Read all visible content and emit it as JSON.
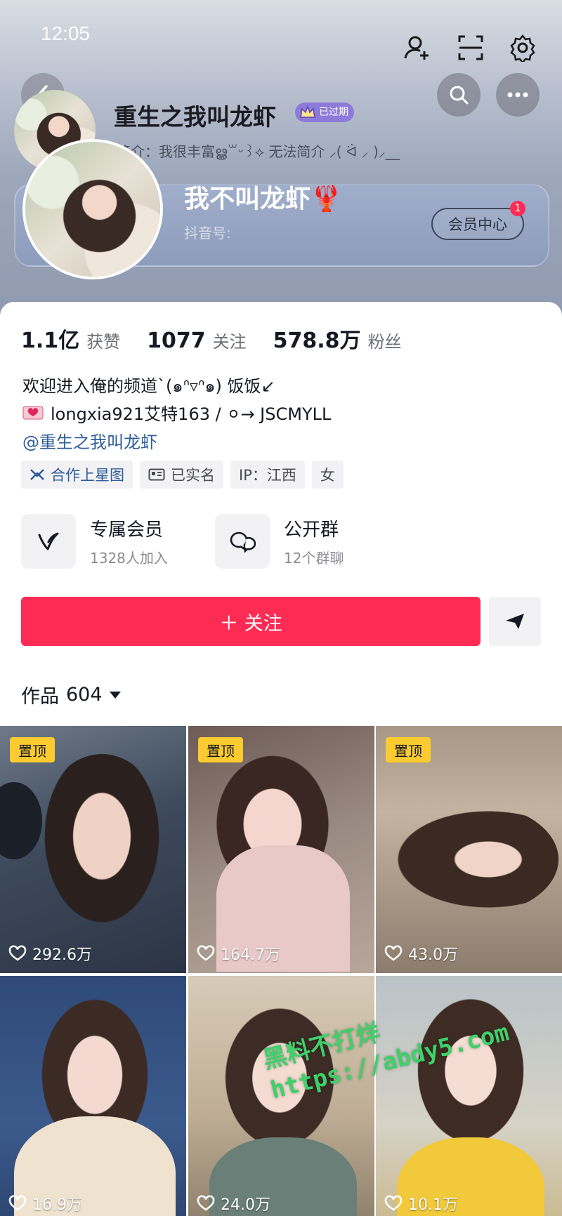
{
  "status_bar": {
    "time": "12:05"
  },
  "header": {
    "mini_name": "重生之我叫龙虾",
    "expired_badge": "已过期",
    "mini_intro": "简介：我很丰富ൠ꒳ᵕ꒱⟡ 无法简介 ⸝( ᐛ ⸝ )⸝__",
    "big_name": "我不叫龙虾🦞",
    "douyin_id_label": "抖音号:",
    "member_center_label": "会员中心",
    "member_center_badge": "1"
  },
  "stats": [
    {
      "value": "1.1亿",
      "label": "获赞"
    },
    {
      "value": "1077",
      "label": "关注"
    },
    {
      "value": "578.8万",
      "label": "粉丝"
    }
  ],
  "bio": {
    "line1": "欢迎进入俺的频道`(๑ᐢ▿ᐢ๑) 饭饭↙",
    "line2": "longxia921艾特163  /  ⚪→  JSCMYLL",
    "mention": "@重生之我叫龙虾"
  },
  "tags": [
    {
      "label": "合作上星图",
      "icon": "star-map-icon"
    },
    {
      "label": "已实名",
      "icon": "id-card-icon"
    },
    {
      "label": "IP：江西",
      "icon": ""
    },
    {
      "label": "女",
      "icon": ""
    }
  ],
  "entries": [
    {
      "title": "专属会员",
      "sub": "1328人加入",
      "icon": "vip-v-icon"
    },
    {
      "title": "公开群",
      "sub": "12个群聊",
      "icon": "group-chat-icon"
    }
  ],
  "follow_button": "＋ 关注",
  "works": {
    "label": "作品",
    "count": "604"
  },
  "grid": [
    {
      "pinned": true,
      "pin_label": "置顶",
      "likes": "292.6万"
    },
    {
      "pinned": true,
      "pin_label": "置顶",
      "likes": "164.7万"
    },
    {
      "pinned": true,
      "pin_label": "置顶",
      "likes": "43.0万"
    },
    {
      "pinned": false,
      "pin_label": "",
      "likes": "16.9万"
    },
    {
      "pinned": false,
      "pin_label": "",
      "likes": "24.0万"
    },
    {
      "pinned": false,
      "pin_label": "",
      "likes": "10.1万"
    }
  ],
  "watermark": {
    "line1": "黑料不打烊",
    "line2": "https://abdy5.com"
  },
  "colors": {
    "accent": "#fe2c55",
    "pin": "#fbcb2f",
    "mention": "#2e5d9b",
    "expired": "#8d7bdb"
  }
}
